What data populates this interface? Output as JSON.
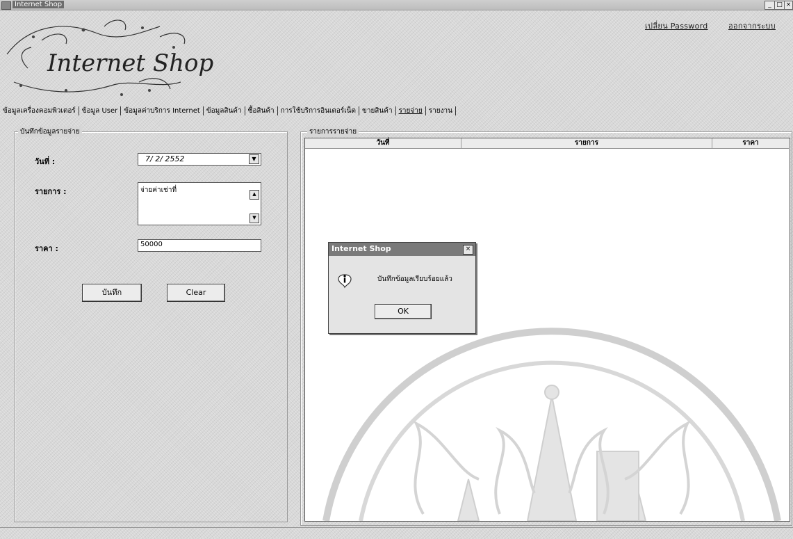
{
  "window": {
    "title": "Internet Shop",
    "controls": [
      "_",
      "□",
      "×"
    ]
  },
  "header": {
    "change_password": "เปลี่ยน Password",
    "logout": "ออกจากระบบ",
    "logo_text": "Internet Shop"
  },
  "menu": [
    {
      "label": "ข้อมูลเครื่องคอมพิวเตอร์"
    },
    {
      "label": "ข้อมูล User"
    },
    {
      "label": "ข้อมูลค่าบริการ Internet"
    },
    {
      "label": "ข้อมูลสินค้า"
    },
    {
      "label": "ซื้อสินค้า"
    },
    {
      "label": "การใช้บริการอินเตอร์เน็ต"
    },
    {
      "label": "ขายสินค้า"
    },
    {
      "label": "รายจ่าย"
    },
    {
      "label": "รายงาน"
    }
  ],
  "form": {
    "group_title": "บันทึกข้อมูลรายจ่าย",
    "date_label": "วันที่ :",
    "date_value": "7/ 2/ 2552",
    "item_label": "รายการ :",
    "item_value": "จ่ายค่าเช่าที่",
    "price_label": "ราคา :",
    "price_value": "50000",
    "save_button": "บันทึก",
    "clear_button": "Clear"
  },
  "list": {
    "group_title": "รายการรายจ่าย",
    "columns": [
      "วันที่",
      "รายการ",
      "ราคา"
    ]
  },
  "dialog": {
    "title": "Internet Shop",
    "message": "บันทึกข้อมูลเรียบร้อยแล้ว",
    "ok_button": "OK",
    "close": "×"
  }
}
